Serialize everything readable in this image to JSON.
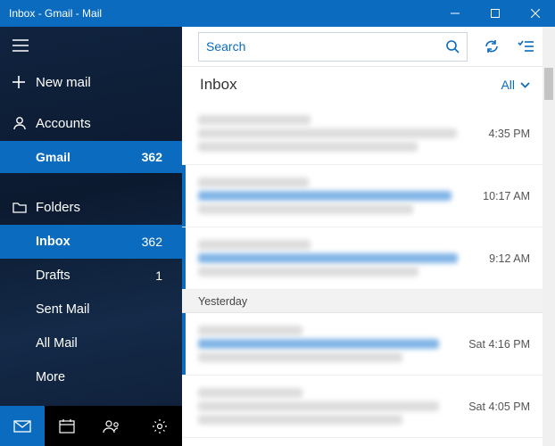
{
  "window": {
    "title": "Inbox - Gmail - Mail"
  },
  "sidebar": {
    "new_mail": "New mail",
    "accounts_label": "Accounts",
    "account": {
      "name": "Gmail",
      "count": "362"
    },
    "folders_label": "Folders",
    "folders": [
      {
        "label": "Inbox",
        "count": "362",
        "selected": true
      },
      {
        "label": "Drafts",
        "count": "1",
        "selected": false
      },
      {
        "label": "Sent Mail",
        "count": "",
        "selected": false
      },
      {
        "label": "All Mail",
        "count": "",
        "selected": false
      },
      {
        "label": "More",
        "count": "",
        "selected": false
      }
    ]
  },
  "search": {
    "placeholder": "Search"
  },
  "list": {
    "title": "Inbox",
    "filter": "All",
    "groups": [
      {
        "label": "",
        "messages": [
          {
            "time": "4:35 PM",
            "unread": false
          },
          {
            "time": "10:17 AM",
            "unread": true
          },
          {
            "time": "9:12 AM",
            "unread": true
          }
        ]
      },
      {
        "label": "Yesterday",
        "messages": [
          {
            "time": "Sat 4:16 PM",
            "unread": true
          },
          {
            "time": "Sat 4:05 PM",
            "unread": false
          }
        ]
      }
    ]
  }
}
